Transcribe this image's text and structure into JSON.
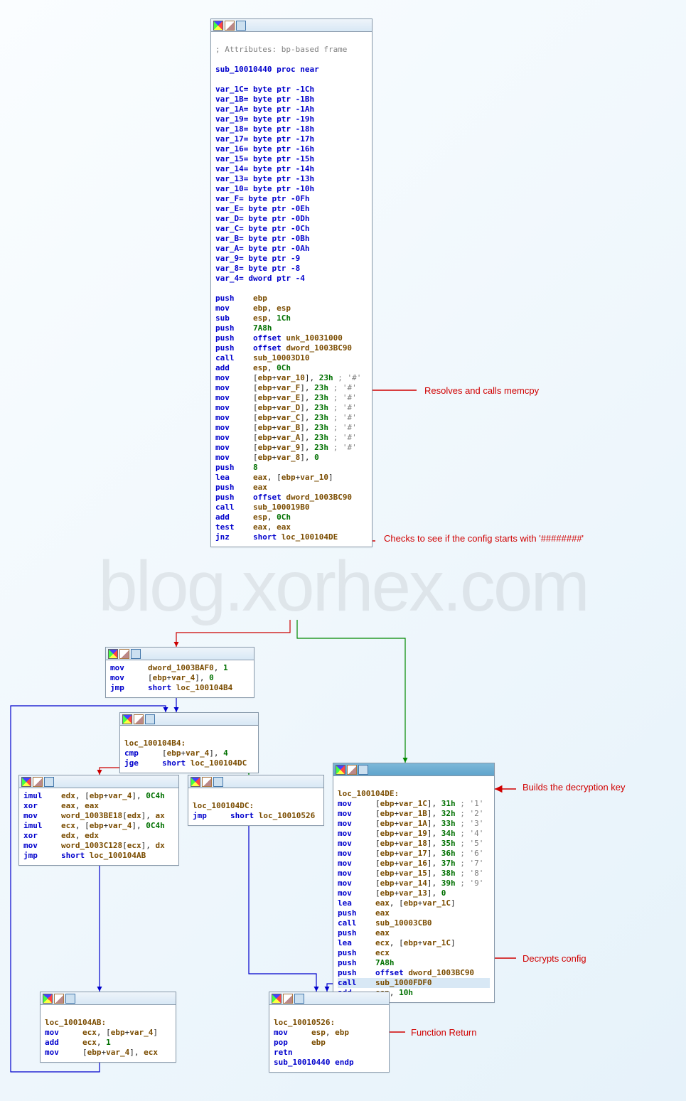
{
  "watermark": "blog.xorhex.com",
  "annotations": {
    "memcpy": "Resolves and calls memcpy",
    "checkhash": "Checks to see if the config starts with\n'########'",
    "buildskey": "Builds the\ndecryption key",
    "decrypts": "Decrypts config",
    "funcret": "Function Return",
    "arrow": "🠔"
  },
  "node0": {
    "comment_attr": "; Attributes: bp-based frame",
    "proc": "sub_10010440 proc near",
    "vars": [
      "var_1C= byte ptr -1Ch",
      "var_1B= byte ptr -1Bh",
      "var_1A= byte ptr -1Ah",
      "var_19= byte ptr -19h",
      "var_18= byte ptr -18h",
      "var_17= byte ptr -17h",
      "var_16= byte ptr -16h",
      "var_15= byte ptr -15h",
      "var_14= byte ptr -14h",
      "var_13= byte ptr -13h",
      "var_10= byte ptr -10h",
      "var_F= byte ptr -0Fh",
      "var_E= byte ptr -0Eh",
      "var_D= byte ptr -0Dh",
      "var_C= byte ptr -0Ch",
      "var_B= byte ptr -0Bh",
      "var_A= byte ptr -0Ah",
      "var_9= byte ptr -9",
      "var_8= byte ptr -8",
      "var_4= dword ptr -4"
    ],
    "l0": "push    ebp",
    "l1": "mov     ebp, esp",
    "l2": "sub     esp, 1Ch",
    "l3": "push    7A8h",
    "l4": "push    offset unk_10031000",
    "l5": "push    offset dword_1003BC90",
    "l6": "call    sub_10003D10",
    "l7": "add     esp, 0Ch",
    "l8": "mov     [ebp+var_10], 23h ; '#'",
    "l9": "mov     [ebp+var_F], 23h ; '#'",
    "l10": "mov     [ebp+var_E], 23h ; '#'",
    "l11": "mov     [ebp+var_D], 23h ; '#'",
    "l12": "mov     [ebp+var_C], 23h ; '#'",
    "l13": "mov     [ebp+var_B], 23h ; '#'",
    "l14": "mov     [ebp+var_A], 23h ; '#'",
    "l15": "mov     [ebp+var_9], 23h ; '#'",
    "l16": "mov     [ebp+var_8], 0",
    "l17": "push    8",
    "l18": "lea     eax, [ebp+var_10]",
    "l19": "push    eax",
    "l20": "push    offset dword_1003BC90",
    "l21": "call    sub_100019B0",
    "l22": "add     esp, 0Ch",
    "l23": "test    eax, eax",
    "l24": "jnz     short loc_100104DE"
  },
  "node1": {
    "l0": "mov     dword_1003BAF0, 1",
    "l1": "mov     [ebp+var_4], 0",
    "l2": "jmp     short loc_100104B4"
  },
  "node2": {
    "label": "loc_100104B4:",
    "l0": "cmp     [ebp+var_4], 4",
    "l1": "jge     short loc_100104DC"
  },
  "node3": {
    "l0": "imul    edx, [ebp+var_4], 0C4h",
    "l1": "xor     eax, eax",
    "l2": "mov     word_1003BE18[edx], ax",
    "l3": "imul    ecx, [ebp+var_4], 0C4h",
    "l4": "xor     edx, edx",
    "l5": "mov     word_1003C128[ecx], dx",
    "l6": "jmp     short loc_100104AB"
  },
  "node4": {
    "label": "loc_100104DC:",
    "l0": "jmp     short loc_10010526"
  },
  "node5": {
    "label": "loc_100104DE:",
    "l0": "mov     [ebp+var_1C], 31h ; '1'",
    "l1": "mov     [ebp+var_1B], 32h ; '2'",
    "l2": "mov     [ebp+var_1A], 33h ; '3'",
    "l3": "mov     [ebp+var_19], 34h ; '4'",
    "l4": "mov     [ebp+var_18], 35h ; '5'",
    "l5": "mov     [ebp+var_17], 36h ; '6'",
    "l6": "mov     [ebp+var_16], 37h ; '7'",
    "l7": "mov     [ebp+var_15], 38h ; '8'",
    "l8": "mov     [ebp+var_14], 39h ; '9'",
    "l9": "mov     [ebp+var_13], 0",
    "l10": "lea     eax, [ebp+var_1C]",
    "l11": "push    eax",
    "l12": "call    sub_10003CB0",
    "l13": "push    eax",
    "l14": "lea     ecx, [ebp+var_1C]",
    "l15": "push    ecx",
    "l16": "push    7A8h",
    "l17": "push    offset dword_1003BC90",
    "l18": "call    sub_1000FDF0",
    "l19": "add     esp, 10h"
  },
  "node6": {
    "label": "loc_100104AB:",
    "l0": "mov     ecx, [ebp+var_4]",
    "l1": "add     ecx, 1",
    "l2": "mov     [ebp+var_4], ecx"
  },
  "node7": {
    "label": "loc_10010526:",
    "l0": "mov     esp, ebp",
    "l1": "pop     ebp",
    "l2": "retn",
    "l3": "sub_10010440 endp"
  }
}
